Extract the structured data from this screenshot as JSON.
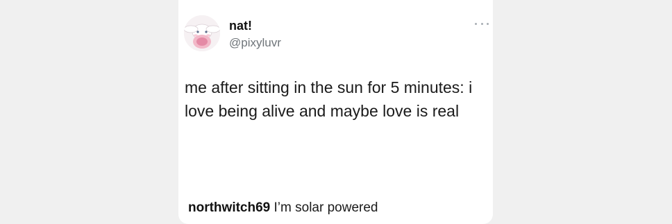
{
  "tweet": {
    "display_name": "nat!",
    "handle": "@pixyluvr",
    "text": "me after sitting in the sun for 5 minutes: i love being alive and maybe love is real",
    "avatar_icon": "cinnamoroll-avatar-icon",
    "more_icon": "more-options-icon"
  },
  "comment": {
    "username": "northwitch69",
    "text": "I’m solar powered"
  }
}
